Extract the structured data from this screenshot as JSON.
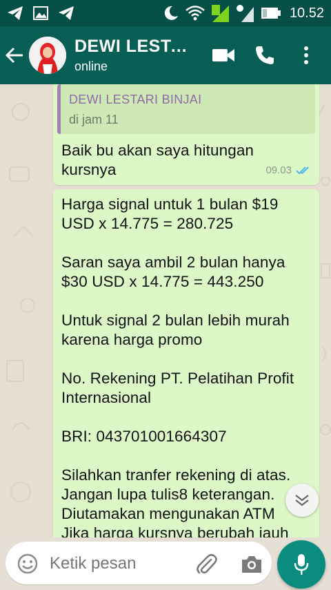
{
  "status_bar": {
    "time": "10.52",
    "icons": [
      "telegram-icon",
      "image-icon",
      "telegram-icon",
      "moon-icon",
      "wifi-icon",
      "signal-icon",
      "signal-icon",
      "battery-icon"
    ]
  },
  "header": {
    "contact_name": "DEWI LESTA...",
    "contact_status": "online",
    "icons": [
      "back-arrow-icon",
      "video-call-icon",
      "phone-icon",
      "more-vert-icon"
    ]
  },
  "messages": [
    {
      "quote_author": "DEWI LESTARI BINJAI",
      "quote_text": "di jam 11",
      "text": "Baik bu akan saya hitungan\nkursnya",
      "time": "09.03",
      "status": "read"
    },
    {
      "text": "Harga signal untuk 1 bulan $19\nUSD x 14.775 = 280.725\n\nSaran saya ambil 2 bulan hanya\n$30 USD x 14.775 = 443.250\n\nUntuk signal 2 bulan lebih murah\nkarena harga promo\n\nNo. Rekening PT. Pelatihan Profit\nInternasional\n\nBRI: 043701001664307\n\nSilahkan tranfer rekening di atas.\nJangan lupa tulis8 keterangan.\nDiutamakan mengunakan ATM\nJika harga kursnya berubah jauh"
    }
  ],
  "composer": {
    "placeholder": "Ketik pesan",
    "icons": [
      "emoji-icon",
      "attach-icon",
      "camera-icon",
      "mic-icon",
      "chevron-down-icon"
    ]
  },
  "colors": {
    "header": "#075e54",
    "status_bar": "#054f46",
    "bubble_out": "#dcf8c6",
    "quote_accent": "#a57fb7",
    "read_ticks": "#4fb6ec",
    "mic_button": "#0a8d7f"
  }
}
